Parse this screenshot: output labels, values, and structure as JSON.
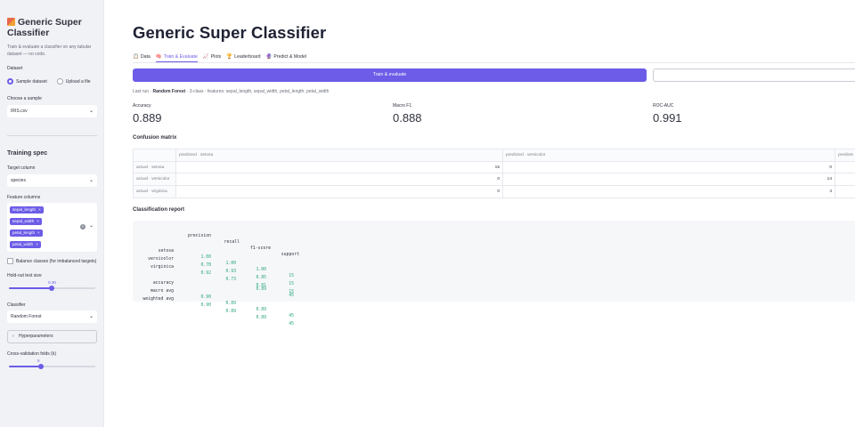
{
  "app": {
    "title": "Generic Super Classifier",
    "accent": "#6c5ce7"
  },
  "sidebar": {
    "title": "Generic Super Classifier",
    "logo_icon": "abacus-icon",
    "description": "Train & evaluate a classifier on any tabular dataset — no code.",
    "dataset_label": "Dataset",
    "dataset_options": [
      "Sample dataset",
      "Upload a file"
    ],
    "dataset_selected": "Sample dataset",
    "sample_label": "Choose a sample",
    "sample_value": "IRIS.csv",
    "training_heading": "Training spec",
    "target_label": "Target column",
    "target_value": "species",
    "features_label": "Feature columns",
    "features": [
      "sepal_length",
      "sepal_width",
      "petal_length",
      "petal_width"
    ],
    "balance_label": "Balance classes (for imbalanced targets)",
    "balance_checked": false,
    "holdout_label": "Hold-out test size",
    "holdout_value": "0.30",
    "holdout_fraction": 0.3,
    "holdout_range": [
      0.1,
      0.5
    ],
    "classifier_label": "Classifier",
    "classifier_value": "Random Forest",
    "hyperparameters_label": "Hyperparameters",
    "cv_label": "Cross-validation folds (k)",
    "cv_value": "5",
    "cv_range": [
      2,
      10
    ]
  },
  "tabs": [
    {
      "label": "Data",
      "icon": "clipboard-icon",
      "active": false
    },
    {
      "label": "Train & Evaluate",
      "icon": "brain-icon",
      "active": true
    },
    {
      "label": "Plots",
      "icon": "chart-icon",
      "active": false
    },
    {
      "label": "Leaderboard",
      "icon": "trophy-icon",
      "active": false
    },
    {
      "label": "Predict & Model",
      "icon": "crystal-ball-icon",
      "active": false
    }
  ],
  "actions": {
    "train_label": "Train & evaluate"
  },
  "last_run": {
    "prefix": "Last run ·",
    "model": "Random Forest",
    "suffix": "· 3-class · features: sepal_length, sepal_width, petal_length, petal_width"
  },
  "metrics": [
    {
      "label": "Accuracy",
      "value": "0.889"
    },
    {
      "label": "Macro F1",
      "value": "0.888"
    },
    {
      "label": "ROC-AUC",
      "value": "0.991"
    }
  ],
  "confusion": {
    "heading": "Confusion matrix",
    "columns": [
      "predicted · setosa",
      "predicted · versicolor",
      "predicted · virginica"
    ],
    "rows": [
      {
        "label": "actual · setosa",
        "values": [
          "15",
          "0"
        ]
      },
      {
        "label": "actual · versicolor",
        "values": [
          "0",
          "14"
        ]
      },
      {
        "label": "actual · virginica",
        "values": [
          "0",
          "4"
        ]
      }
    ],
    "visible_third_header": "predicte"
  },
  "report": {
    "heading": "Classification report",
    "headers": [
      "precision",
      "recall",
      "f1-score",
      "support"
    ],
    "rows": [
      {
        "label": "setosa",
        "values": [
          "1.00",
          "1.00",
          "1.00",
          "15"
        ]
      },
      {
        "label": "versicolor",
        "values": [
          "0.78",
          "0.93",
          "0.85",
          "15"
        ]
      },
      {
        "label": "virginica",
        "values": [
          "0.92",
          "0.73",
          "0.81",
          "15"
        ]
      },
      {
        "label": "accuracy",
        "values": [
          "",
          "",
          "0.89",
          "45"
        ]
      },
      {
        "label": "macro avg",
        "values": [
          "0.90",
          "0.89",
          "0.89",
          "45"
        ]
      },
      {
        "label": "weighted avg",
        "values": [
          "0.90",
          "0.89",
          "0.89",
          "45"
        ]
      }
    ]
  }
}
